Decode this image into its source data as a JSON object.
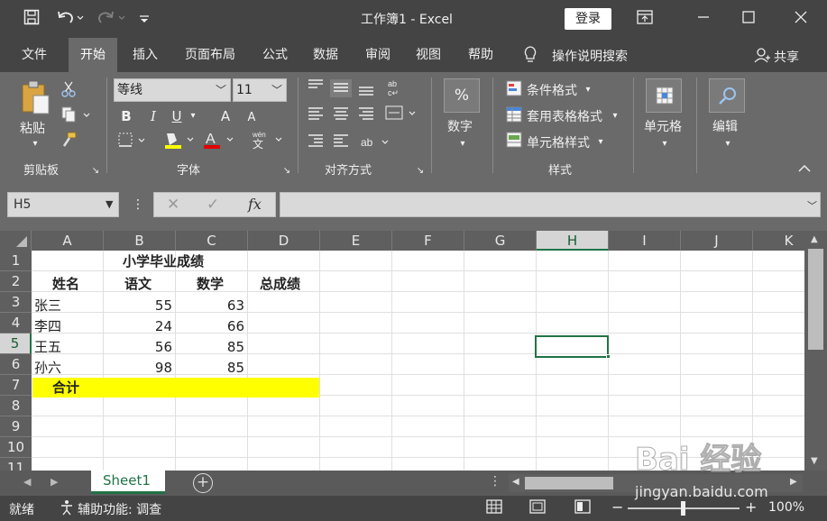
{
  "titlebar": {
    "title": "工作簿1  -  Excel",
    "login": "登录",
    "save_icon": "save-icon",
    "undo_icon": "undo-icon",
    "redo_icon": "redo-icon",
    "customize_icon": "customize-icon"
  },
  "tabs": [
    "文件",
    "开始",
    "插入",
    "页面布局",
    "公式",
    "数据",
    "审阅",
    "视图",
    "帮助"
  ],
  "tell_me": "操作说明搜索",
  "share": "共享",
  "ribbon": {
    "clipboard": {
      "paste": "粘贴",
      "group": "剪贴板"
    },
    "font": {
      "name": "等线",
      "size": "11",
      "group": "字体",
      "bold": "B",
      "italic": "I",
      "underline": "U",
      "grow": "A",
      "shrink": "A",
      "color_letter": "A",
      "phonetic": "wén"
    },
    "alignment": {
      "group": "对齐方式"
    },
    "number": {
      "label": "数字",
      "symbol": "%"
    },
    "styles": {
      "conditional": "条件格式",
      "table": "套用表格格式",
      "cell_styles": "单元格样式",
      "group": "样式"
    },
    "cells": {
      "label": "单元格"
    },
    "editing": {
      "label": "编辑"
    }
  },
  "formula_bar": {
    "name_box": "H5",
    "fx": "fx",
    "value": ""
  },
  "grid": {
    "columns": [
      "A",
      "B",
      "C",
      "D",
      "E",
      "F",
      "G",
      "H",
      "I",
      "J",
      "K"
    ],
    "selected_column": "H",
    "rows": [
      "1",
      "2",
      "3",
      "4",
      "5",
      "6",
      "7",
      "8",
      "9",
      "10",
      "11"
    ],
    "selected_row": "5",
    "title": "小学毕业成绩",
    "headers": [
      "姓名",
      "语文",
      "数学",
      "总成绩"
    ],
    "data": [
      [
        "张三",
        "55",
        "63"
      ],
      [
        "李四",
        "24",
        "66"
      ],
      [
        "王五",
        "56",
        "85"
      ],
      [
        "孙六",
        "98",
        "85"
      ]
    ],
    "total_label": "合计",
    "highlight_color": "#ffff00",
    "selection_color": "#217346"
  },
  "sheets": {
    "active": "Sheet1",
    "add": "+"
  },
  "statusbar": {
    "ready": "就绪",
    "accessibility": "辅助功能: 调查",
    "zoom": "100%",
    "minus": "−",
    "plus": "+"
  },
  "watermark": {
    "brand": "Bai 经验",
    "url": "jingyan.baidu.com"
  }
}
